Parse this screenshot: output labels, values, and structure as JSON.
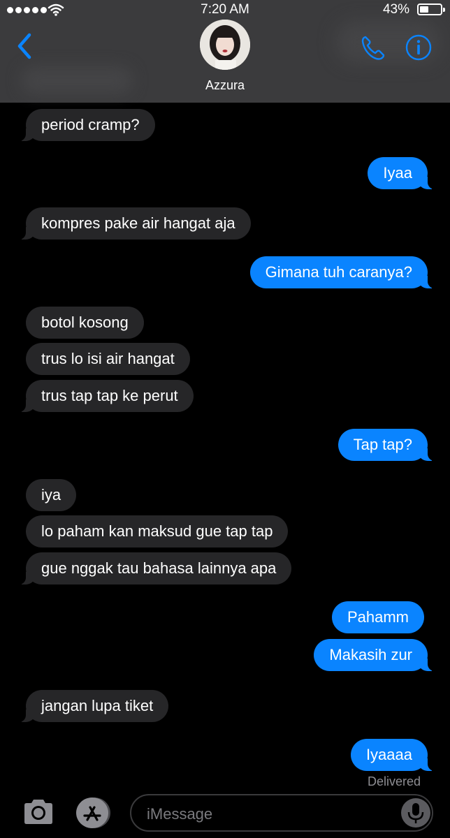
{
  "status_bar": {
    "time": "7:20 AM",
    "battery_percent_text": "43%",
    "battery_level": 0.43,
    "signal_icon": "signal-dots-icon",
    "wifi_icon": "wifi-icon"
  },
  "header": {
    "contact_name": "Azzura",
    "back_icon": "chevron-left-icon",
    "call_icon": "phone-icon",
    "info_icon": "info-icon"
  },
  "colors": {
    "accent": "#0a84ff",
    "incoming_bubble": "#262628",
    "header_bg": "#3b3b3d",
    "background": "#000000"
  },
  "messages": [
    {
      "dir": "in",
      "text": "period cramp?"
    },
    {
      "dir": "out",
      "text": "Iyaa"
    },
    {
      "dir": "in",
      "text": "kompres pake air hangat aja"
    },
    {
      "dir": "out",
      "text": "Gimana tuh caranya?"
    },
    {
      "dir": "in",
      "text": "botol kosong"
    },
    {
      "dir": "in",
      "text": "trus lo isi air hangat"
    },
    {
      "dir": "in",
      "text": "trus tap tap ke perut"
    },
    {
      "dir": "out",
      "text": "Tap tap?"
    },
    {
      "dir": "in",
      "text": "iya"
    },
    {
      "dir": "in",
      "text": "lo paham kan maksud gue tap tap"
    },
    {
      "dir": "in",
      "text": "gue nggak tau bahasa lainnya apa"
    },
    {
      "dir": "out",
      "text": "Pahamm"
    },
    {
      "dir": "out",
      "text": "Makasih zur"
    },
    {
      "dir": "in",
      "text": "jangan lupa tiket"
    },
    {
      "dir": "out",
      "text": "Iyaaaa"
    }
  ],
  "delivery_status": "Delivered",
  "composer": {
    "placeholder": "iMessage",
    "camera_icon": "camera-icon",
    "apps_icon": "app-store-icon",
    "mic_icon": "microphone-icon"
  }
}
